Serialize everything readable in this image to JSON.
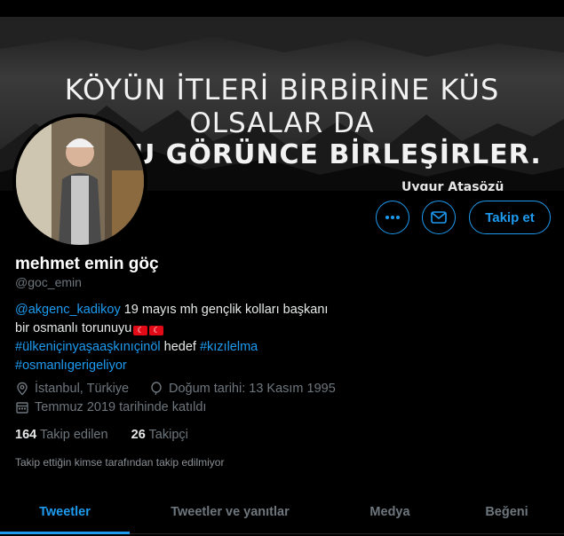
{
  "banner": {
    "line1": "KÖYÜN İTLERİ BİRBİRİNE KÜS",
    "line2": "OLSALAR DA",
    "line3": "U GÖRÜNCE BİRLEŞİRLER.",
    "source": "Uygur Atasözü"
  },
  "profile": {
    "name": "mehmet emin göç",
    "handle": "@goc_emin",
    "bio": {
      "mention": "@akgenc_kadikoy",
      "text1": " 19 mayıs mh gençlik kolları başkanı",
      "text2": "bir osmanlı torunuyu",
      "hashtag1": "#ülkeniçinyaşaaşkınıçinöl",
      "text3": " hedef ",
      "hashtag2": "#kızılelma",
      "hashtag3": "#osmanlıgerigeliyor"
    },
    "location": "İstanbul, Türkiye",
    "birthday": "Doğum tarihi: 13 Kasım 1995",
    "joined": "Temmuz 2019 tarihinde katıldı",
    "following_count": "164",
    "following_label": "Takip edilen",
    "followers_count": "26",
    "followers_label": "Takipçi",
    "notice": "Takip ettiğin kimse tarafından takip edilmiyor"
  },
  "actions": {
    "more_icon": "more-icon",
    "message_icon": "envelope-icon",
    "follow_label": "Takip et"
  },
  "tabs": [
    {
      "label": "Tweetler",
      "active": true
    },
    {
      "label": "Tweetler ve yanıtlar",
      "active": false
    },
    {
      "label": "Medya",
      "active": false
    },
    {
      "label": "Beğeni",
      "active": false
    }
  ],
  "colors": {
    "accent": "#1d9bf0",
    "background": "#000000",
    "secondary_text": "#6e767d",
    "flag": "#e30a17"
  }
}
